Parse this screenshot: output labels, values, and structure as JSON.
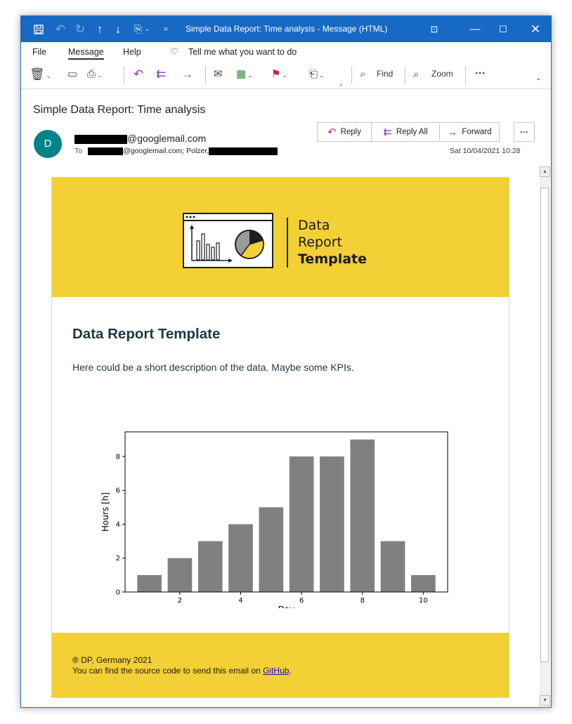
{
  "window": {
    "title": "Simple Data Report: Time analysis  -  Message (HTML)"
  },
  "menu": {
    "file": "File",
    "message": "Message",
    "help": "Help",
    "tell_me": "Tell me what you want to do"
  },
  "ribbon": {
    "find": "Find",
    "zoom": "Zoom",
    "more": "···"
  },
  "message": {
    "subject": "Simple Data Report: Time analysis",
    "avatar_letter": "D",
    "from_suffix": "@googlemail.com",
    "to_label": "To",
    "to_text_1": "@googlemail.com; Polzer,",
    "date": "Sat 10/04/2021 10:28"
  },
  "actions": {
    "reply": "Reply",
    "reply_all": "Reply All",
    "forward": "Forward",
    "more": "···"
  },
  "email": {
    "logo_line1": "Data",
    "logo_line2": "Report",
    "logo_line3": "Template",
    "title": "Data Report Template",
    "description": "Here could be a short description of the data. Maybe some KPIs.",
    "footer_line1": "® DP, Germany 2021",
    "footer_prefix": "You can find the source code to send this email on ",
    "footer_link": "GitHub",
    "footer_suffix": "."
  },
  "chart_data": {
    "type": "bar",
    "x": [
      1,
      2,
      3,
      4,
      5,
      6,
      7,
      8,
      9,
      10
    ],
    "values": [
      1,
      2,
      3,
      4,
      5,
      8,
      8,
      9,
      3,
      1
    ],
    "xlabel": "Day",
    "ylabel": "Hours [h]",
    "xticks": [
      2,
      4,
      6,
      8,
      10
    ],
    "yticks": [
      0,
      2,
      4,
      6,
      8
    ],
    "xlim": [
      0.2,
      10.8
    ],
    "ylim": [
      0,
      9.45
    ],
    "grid": false,
    "bar_color": "#808080"
  },
  "colors": {
    "titlebar": "#1769c4",
    "banner": "#f3d035",
    "avatar": "#038387",
    "heading": "#1e3642"
  }
}
